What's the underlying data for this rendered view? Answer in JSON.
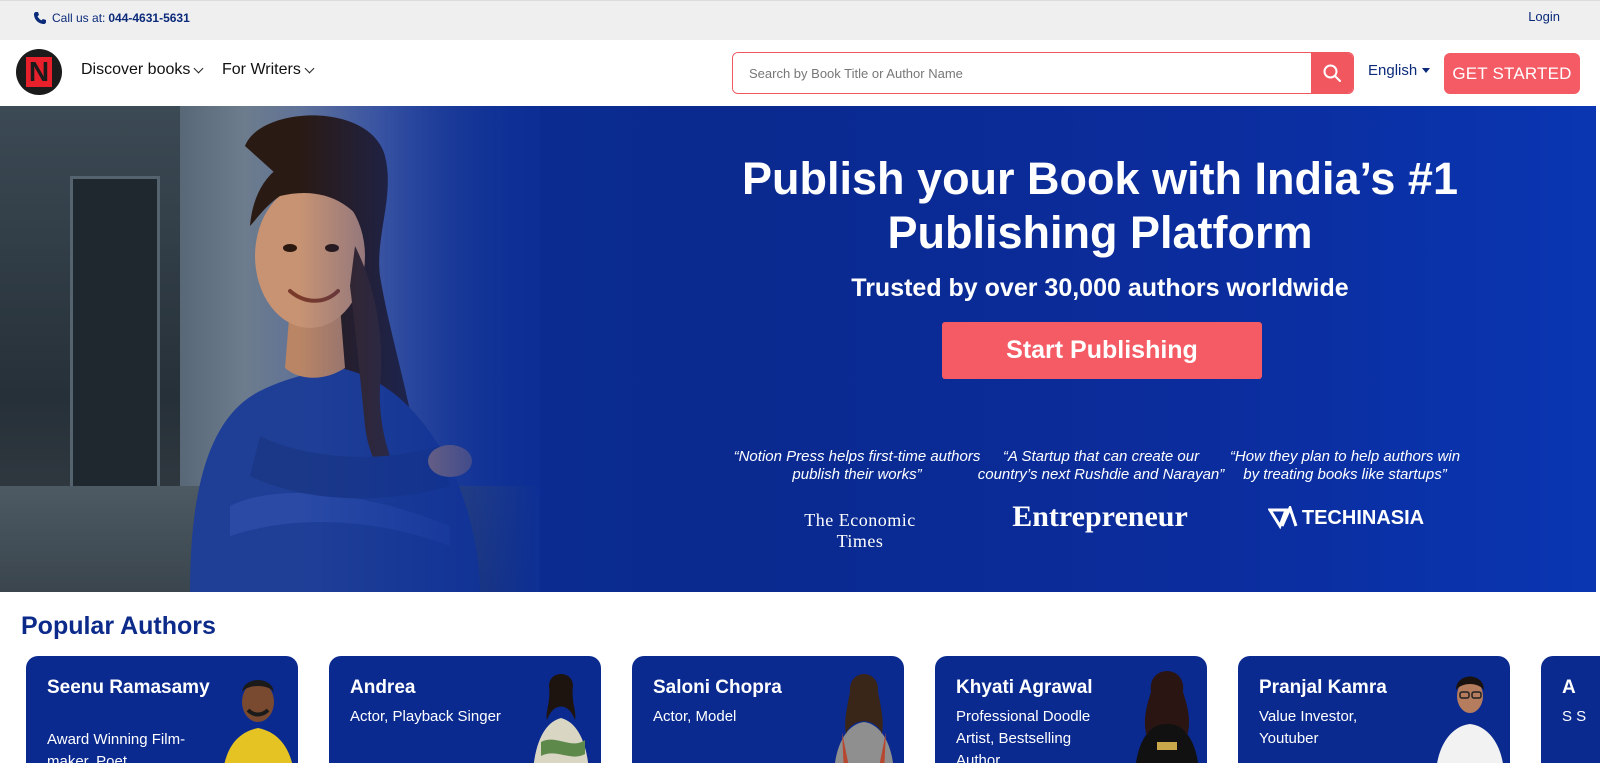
{
  "topbar": {
    "call_label": "Call us at:",
    "phone": "044-4631-5631",
    "login": "Login",
    "phone_icon": "phone-icon"
  },
  "header": {
    "logo_letter": "N",
    "nav": [
      {
        "label": "Discover books"
      },
      {
        "label": "For Writers"
      }
    ],
    "search": {
      "placeholder": "Search by Book Title or Author Name",
      "icon": "search-icon"
    },
    "language": "English",
    "cta": "GET STARTED"
  },
  "hero": {
    "title_line1": "Publish your Book with India’s #1",
    "title_line2": "Publishing Platform",
    "subtitle": "Trusted by over 30,000 authors worldwide",
    "cta": "Start Publishing",
    "quotes": [
      {
        "text": "“Notion Press helps first-time authors publish their works”",
        "source": "The Economic Times"
      },
      {
        "text": "“A Startup that can create our country’s next Rushdie and Narayan”",
        "source": "Entrepreneur"
      },
      {
        "text": "“How they plan to help authors win by treating books like startups”",
        "source": "TECHINASIA"
      }
    ]
  },
  "popular_authors": {
    "title": "Popular Authors",
    "cards": [
      {
        "name": "Seenu Ramasamy",
        "role": "Award Winning Film-maker, Poet"
      },
      {
        "name": "Andrea",
        "role": "Actor, Playback Singer"
      },
      {
        "name": "Saloni Chopra",
        "role": "Actor, Model"
      },
      {
        "name": "Khyati Agrawal",
        "role": "Professional Doodle Artist, Bestselling Author"
      },
      {
        "name": "Pranjal Kamra",
        "role": "Value Investor, Youtuber"
      },
      {
        "name": "A",
        "role": "S S"
      }
    ]
  },
  "colors": {
    "brand_blue": "#0b2a8f",
    "accent_red": "#f45b64",
    "topbar_bg": "#efefef"
  }
}
